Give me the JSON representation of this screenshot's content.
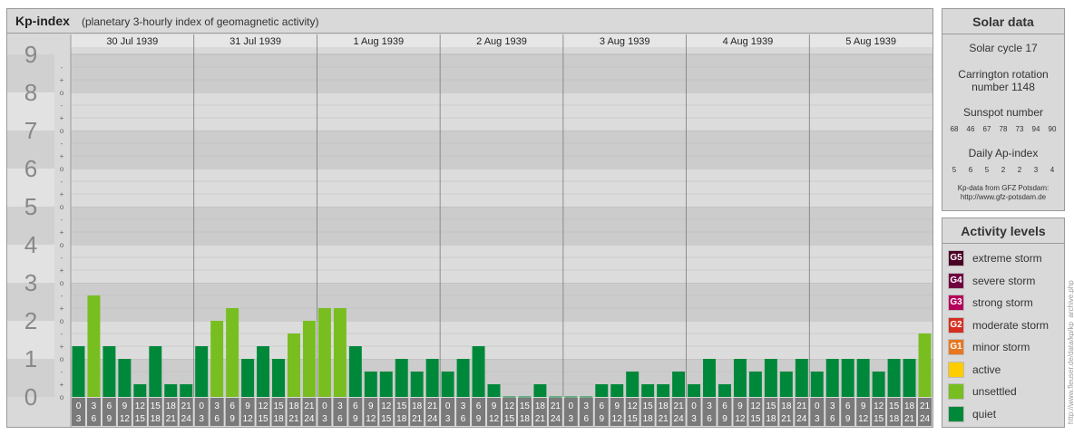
{
  "header": {
    "title": "Kp-index",
    "subtitle": "(planetary 3-hourly index of geomagnetic activity)"
  },
  "chart_data": {
    "type": "bar",
    "title": "Kp-index",
    "subtitle": "(planetary 3-hourly index of geomagnetic activity)",
    "ylim": [
      0,
      9
    ],
    "y_ticks": [
      "0",
      "1",
      "2",
      "3",
      "4",
      "5",
      "6",
      "7",
      "8",
      "9"
    ],
    "y_minor_ticks": [
      "-",
      "o",
      "+"
    ],
    "days": [
      "30 Jul 1939",
      "31 Jul 1939",
      "1 Aug 1939",
      "2 Aug 1939",
      "3 Aug 1939",
      "4 Aug 1939",
      "5 Aug 1939"
    ],
    "interval_labels": [
      [
        "0",
        "3"
      ],
      [
        "3",
        "6"
      ],
      [
        "6",
        "9"
      ],
      [
        "9",
        "12"
      ],
      [
        "12",
        "15"
      ],
      [
        "15",
        "18"
      ],
      [
        "18",
        "21"
      ],
      [
        "21",
        "24"
      ]
    ],
    "values": [
      1.333,
      2.667,
      1.333,
      1.0,
      0.333,
      1.333,
      0.333,
      0.333,
      1.333,
      2.0,
      2.333,
      1.0,
      1.333,
      1.0,
      1.667,
      2.0,
      2.333,
      2.333,
      1.333,
      0.667,
      0.667,
      1.0,
      0.667,
      1.0,
      0.667,
      1.0,
      1.333,
      0.333,
      0.0,
      0.0,
      0.333,
      0.0,
      0.0,
      0.0,
      0.333,
      0.333,
      0.667,
      0.333,
      0.333,
      0.667,
      0.333,
      1.0,
      0.333,
      1.0,
      0.667,
      1.0,
      0.667,
      1.0,
      0.667,
      1.0,
      1.0,
      1.0,
      0.667,
      1.0,
      1.0,
      1.667
    ],
    "colors": {
      "quiet": "#00883a",
      "unsettled": "#78be20",
      "band_dark": "#cccccc",
      "band_light": "#dcdcdc",
      "axis_label": "#888888"
    }
  },
  "solar": {
    "title": "Solar data",
    "cycle": "Solar cycle 17",
    "carrington_line1": "Carrington rotation",
    "carrington_line2": "number 1148",
    "sunspot_label": "Sunspot number",
    "sunspot_values": [
      "68",
      "46",
      "67",
      "78",
      "73",
      "94",
      "90"
    ],
    "ap_label": "Daily Ap-index",
    "ap_values": [
      "5",
      "6",
      "5",
      "2",
      "2",
      "3",
      "4"
    ],
    "source_line1": "Kp-data from GFZ Potsdam:",
    "source_line2": "http://www.gfz-potsdam.de"
  },
  "activity": {
    "title": "Activity levels",
    "levels": [
      {
        "code": "G5",
        "label": "extreme storm",
        "color": "#4b0026"
      },
      {
        "code": "G4",
        "label": "severe storm",
        "color": "#6e0040"
      },
      {
        "code": "G3",
        "label": "strong storm",
        "color": "#b4005a"
      },
      {
        "code": "G2",
        "label": "moderate storm",
        "color": "#d62d20"
      },
      {
        "code": "G1",
        "label": "minor storm",
        "color": "#e87722"
      },
      {
        "code": "",
        "label": "active",
        "color": "#ffcc00"
      },
      {
        "code": "",
        "label": "unsettled",
        "color": "#78be20"
      },
      {
        "code": "",
        "label": "quiet",
        "color": "#00883a"
      }
    ]
  },
  "watermark": "http://www.fleuser.de/data/kp/kp_archive.php"
}
